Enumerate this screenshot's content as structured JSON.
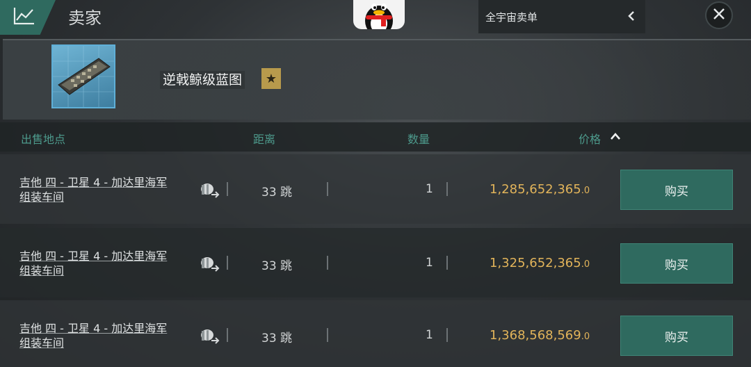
{
  "header": {
    "title": "卖家",
    "market_scope": "全宇宙卖单",
    "icons": {
      "tab": "chart-icon",
      "penguin": "penguin-icon",
      "chevron": "chevron-left-icon",
      "close": "close-icon"
    }
  },
  "item": {
    "name": "逆戟鲸级蓝图",
    "badge_icon": "star-icon"
  },
  "columns": {
    "location": "出售地点",
    "distance": "距离",
    "quantity": "数量",
    "price": "价格"
  },
  "orders": [
    {
      "location_line1": "吉他 四 - 卫星 4 - 加达里海军",
      "location_line2": "组装车间",
      "distance": "33 跳",
      "quantity": "1",
      "price": "1,285,652,365",
      "price_decimal": ".0",
      "buy_label": "购买"
    },
    {
      "location_line1": "吉他 四 - 卫星 4 - 加达里海军",
      "location_line2": "组装车间",
      "distance": "33 跳",
      "quantity": "1",
      "price": "1,325,652,365",
      "price_decimal": ".0",
      "buy_label": "购买"
    },
    {
      "location_line1": "吉他 四 - 卫星 4 - 加达里海军",
      "location_line2": "组装车间",
      "distance": "33 跳",
      "quantity": "1",
      "price": "1,368,568,569",
      "price_decimal": ".0",
      "buy_label": "购买"
    }
  ],
  "colors": {
    "accent": "#2f6a5f",
    "price": "#e2b45a",
    "header_text": "#4d9a8c"
  }
}
